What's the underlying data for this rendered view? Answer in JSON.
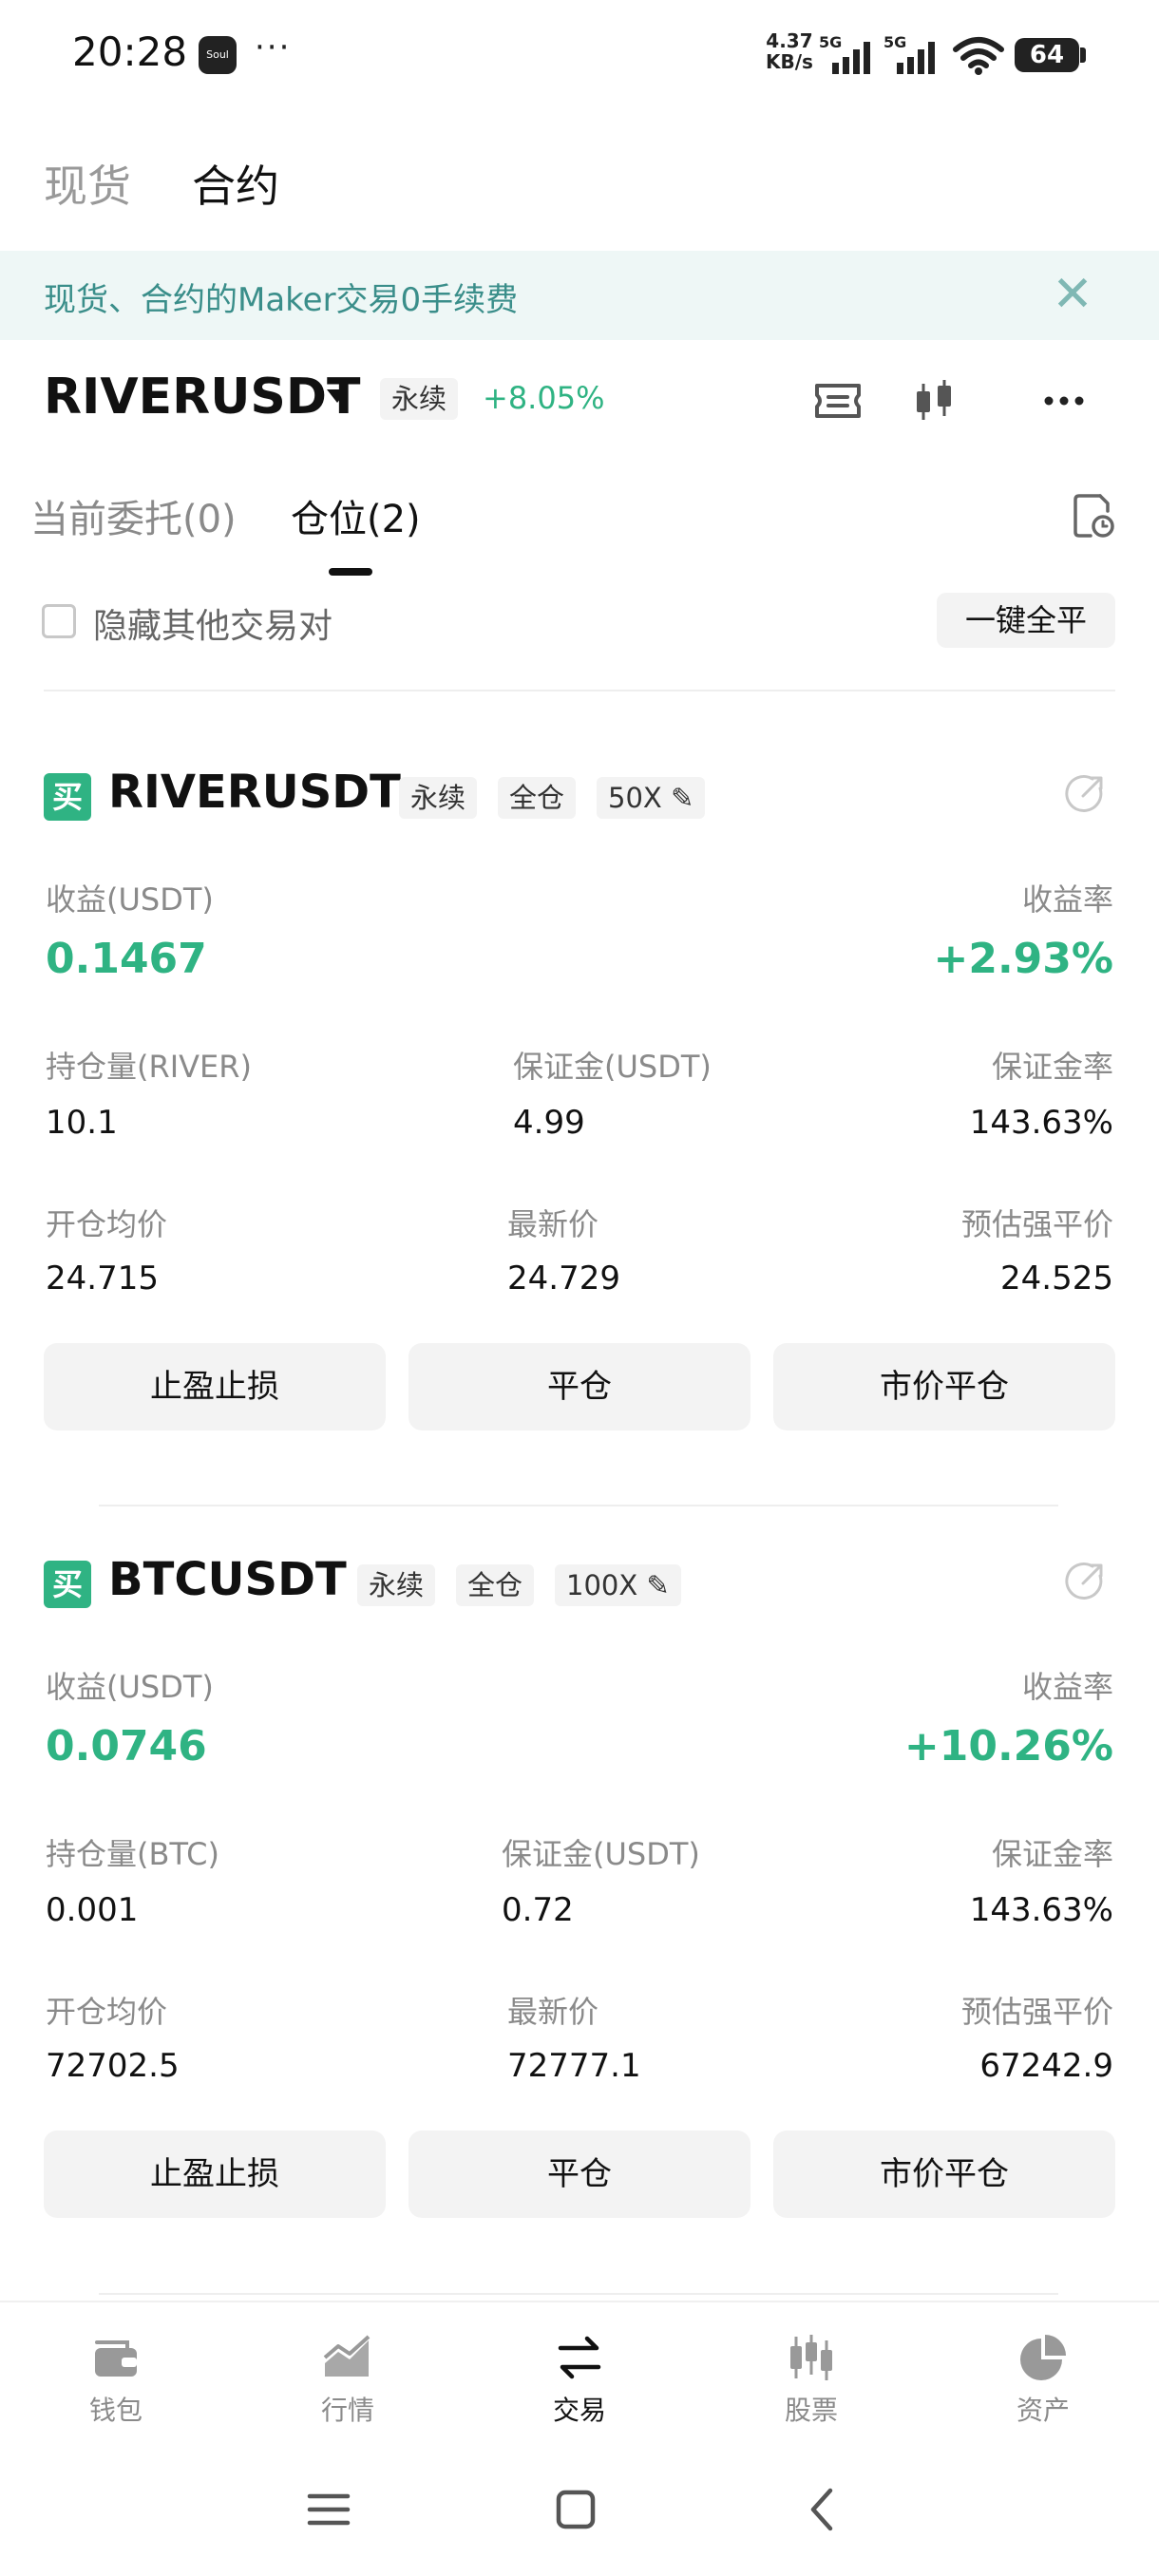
{
  "status_bar": {
    "time": "20:28",
    "app_badge": "Soul",
    "dots": "···",
    "speed_top": "4.37",
    "speed_unit": "KB/s",
    "network_1": "5G",
    "network_2": "5G",
    "battery": "64"
  },
  "top_tabs": {
    "spot": "现货",
    "futures": "合约"
  },
  "banner": {
    "text": "现货、合约的Maker交易0手续费",
    "close": "✕"
  },
  "symbol_header": {
    "symbol": "RIVERUSDT",
    "tag": "永续",
    "change": "+8.05%"
  },
  "sub_tabs": {
    "orders": "当前委托(0)",
    "positions": "仓位(2)"
  },
  "filter": {
    "hide_label": "隐藏其他交易对",
    "close_all": "一键全平"
  },
  "positions": [
    {
      "side": "买",
      "symbol": "RIVERUSDT",
      "tags": [
        "永续",
        "全仓",
        "50X"
      ],
      "pnl_label": "收益(USDT)",
      "pnl_value": "0.1467",
      "roi_label": "收益率",
      "roi_value": "+2.93%",
      "size_label": "持仓量(RIVER)",
      "size_value": "10.1",
      "margin_label": "保证金(USDT)",
      "margin_value": "4.99",
      "margin_ratio_label": "保证金率",
      "margin_ratio_value": "143.63%",
      "entry_label": "开仓均价",
      "entry_value": "24.715",
      "last_label": "最新价",
      "last_value": "24.729",
      "liq_label": "预估强平价",
      "liq_value": "24.525",
      "buttons": [
        "止盈止损",
        "平仓",
        "市价平仓"
      ]
    },
    {
      "side": "买",
      "symbol": "BTCUSDT",
      "tags": [
        "永续",
        "全仓",
        "100X"
      ],
      "pnl_label": "收益(USDT)",
      "pnl_value": "0.0746",
      "roi_label": "收益率",
      "roi_value": "+10.26%",
      "size_label": "持仓量(BTC)",
      "size_value": "0.001",
      "margin_label": "保证金(USDT)",
      "margin_value": "0.72",
      "margin_ratio_label": "保证金率",
      "margin_ratio_value": "143.63%",
      "entry_label": "开仓均价",
      "entry_value": "72702.5",
      "last_label": "最新价",
      "last_value": "72777.1",
      "liq_label": "预估强平价",
      "liq_value": "67242.9",
      "buttons": [
        "止盈止损",
        "平仓",
        "市价平仓"
      ]
    }
  ],
  "bottom_nav": [
    {
      "label": "钱包",
      "icon": "wallet-icon"
    },
    {
      "label": "行情",
      "icon": "market-chart-icon"
    },
    {
      "label": "交易",
      "icon": "swap-arrows-icon",
      "active": true
    },
    {
      "label": "股票",
      "icon": "stock-candles-icon"
    },
    {
      "label": "资产",
      "icon": "pie-chart-icon"
    }
  ],
  "colors": {
    "accent_green": "#2fb383",
    "banner_bg": "#eef7f6",
    "banner_text": "#3a8e8a",
    "button_bg": "#f3f3f3"
  }
}
